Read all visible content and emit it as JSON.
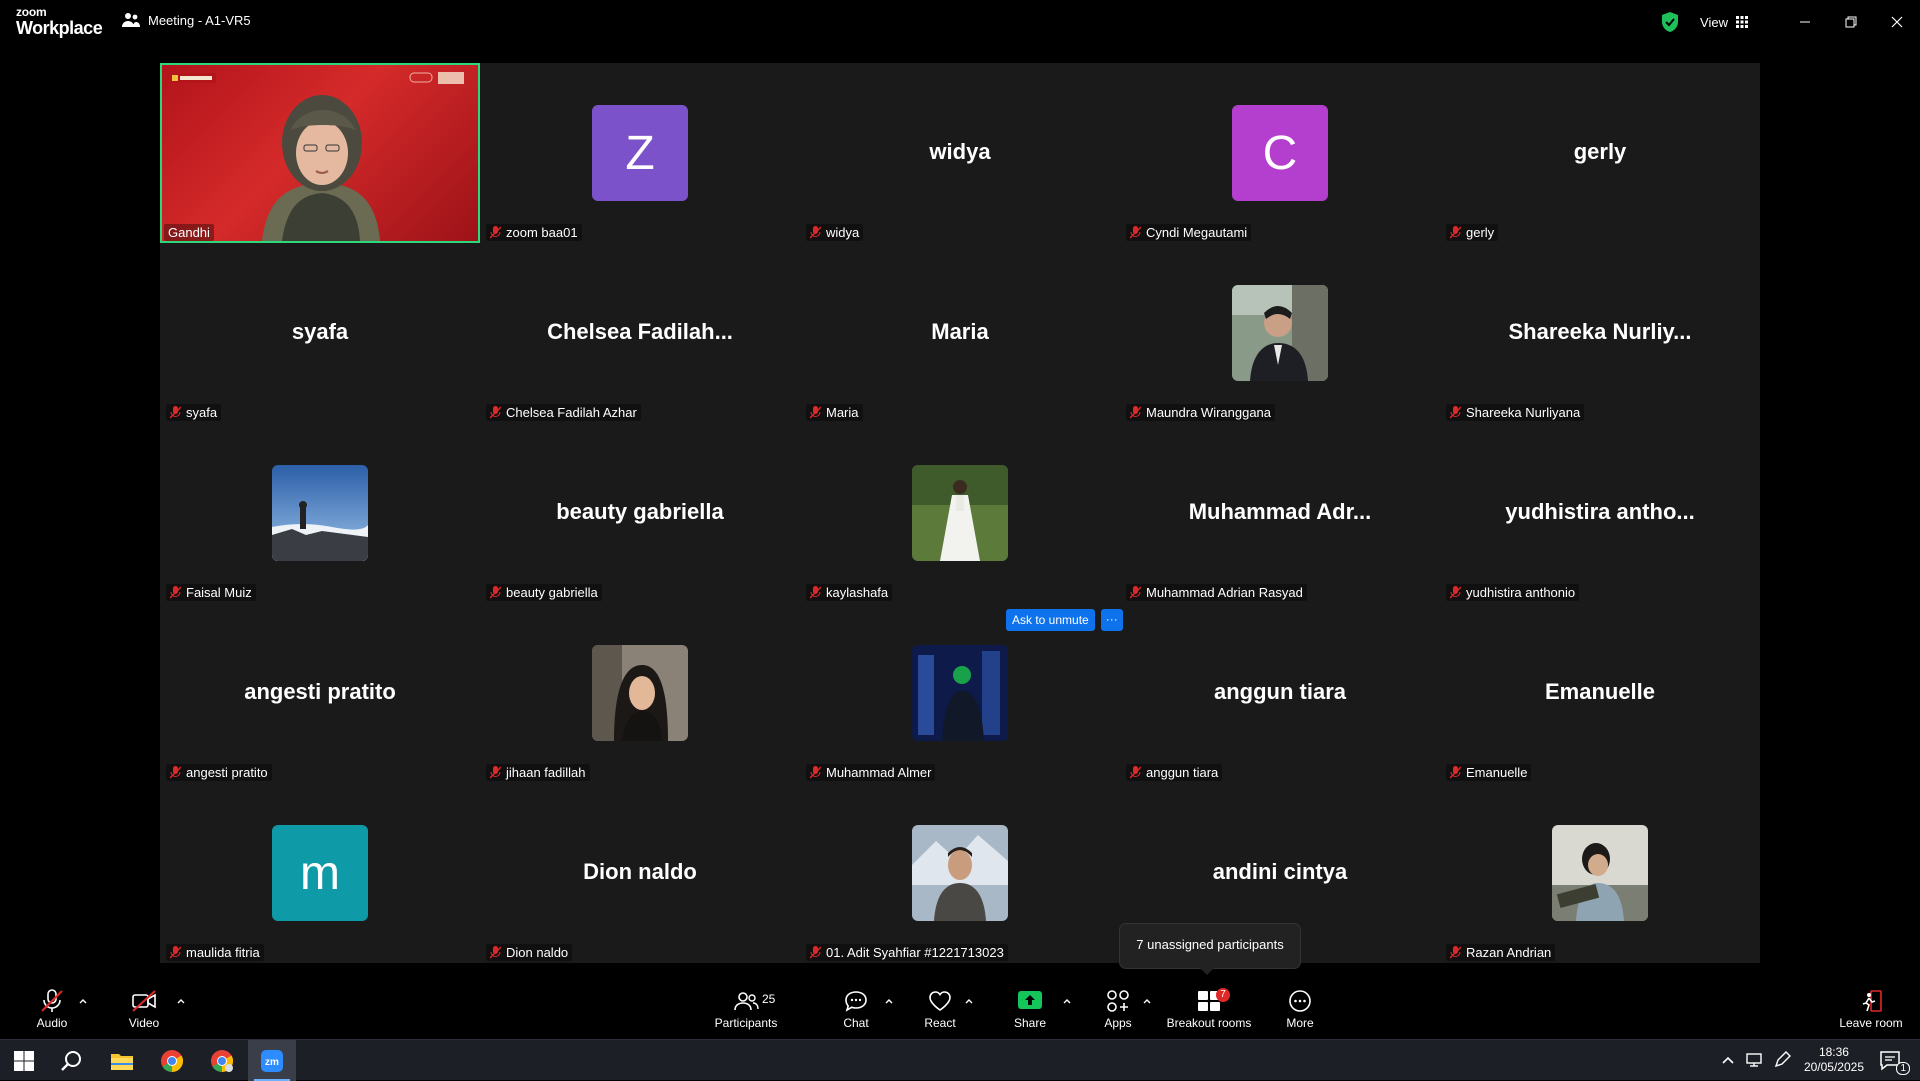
{
  "app": {
    "logo_line1": "zoom",
    "logo_line2": "Workplace",
    "meeting_title": "Meeting - A1-VR5",
    "view_label": "View",
    "colors": {
      "accent_green": "#2ed77a",
      "accent_blue": "#0e72ed",
      "tile_bg": "#1a1a1a",
      "muted_red": "#e02828"
    }
  },
  "gallery": {
    "speaker_name": "Gandhi",
    "tiles": [
      {
        "label": "zoom baa01",
        "display": "Z",
        "avatar_color": "#7b52c9"
      },
      {
        "label": "widya",
        "display": "widya"
      },
      {
        "label": "Cyndi Megautami",
        "display": "C",
        "avatar_color": "#b43fce"
      },
      {
        "label": "gerly",
        "display": "gerly"
      },
      {
        "label": "syafa",
        "display": "syafa"
      },
      {
        "label": "Chelsea Fadilah Azhar",
        "display": "Chelsea  Fadilah..."
      },
      {
        "label": "Maria",
        "display": "Maria"
      },
      {
        "label": "Maundra Wiranggana",
        "display": "photo"
      },
      {
        "label": "Shareeka Nurliyana",
        "display": "Shareeka  Nurliy..."
      },
      {
        "label": "Faisal Muiz",
        "display": "photo"
      },
      {
        "label": "beauty gabriella",
        "display": "beauty gabriella"
      },
      {
        "label": "kaylashafa",
        "display": "photo"
      },
      {
        "label": "Muhammad Adrian Rasyad",
        "display": "Muhammad  Adr..."
      },
      {
        "label": "yudhistira anthonio",
        "display": "yudhistira  antho..."
      },
      {
        "label": "angesti pratito",
        "display": "angesti pratito"
      },
      {
        "label": "jihaan fadillah",
        "display": "photo"
      },
      {
        "label": "Muhammad Almer",
        "display": "photo"
      },
      {
        "label": "anggun tiara",
        "display": "anggun tiara"
      },
      {
        "label": "Emanuelle",
        "display": "Emanuelle"
      },
      {
        "label": "maulida fitria",
        "display": "m",
        "avatar_color": "#0e9aa7"
      },
      {
        "label": "Dion naldo",
        "display": "Dion naldo"
      },
      {
        "label": "01. Adit Syahfiar #1221713023",
        "display": "photo"
      },
      {
        "label": "andini cintya",
        "display": "andini cintya"
      },
      {
        "label": "Razan Andrian",
        "display": "photo"
      }
    ],
    "ask_unmute_label": "Ask to unmute",
    "more_dots": "···",
    "tooltip": "7 unassigned participants"
  },
  "toolbar": {
    "audio": "Audio",
    "video": "Video",
    "participants": "Participants",
    "participants_count": "25",
    "chat": "Chat",
    "react": "React",
    "share": "Share",
    "apps": "Apps",
    "breakout": "Breakout rooms",
    "breakout_badge": "7",
    "more": "More",
    "leave": "Leave room"
  },
  "taskbar": {
    "time": "18:36",
    "date": "20/05/2025",
    "notif_count": "1"
  }
}
